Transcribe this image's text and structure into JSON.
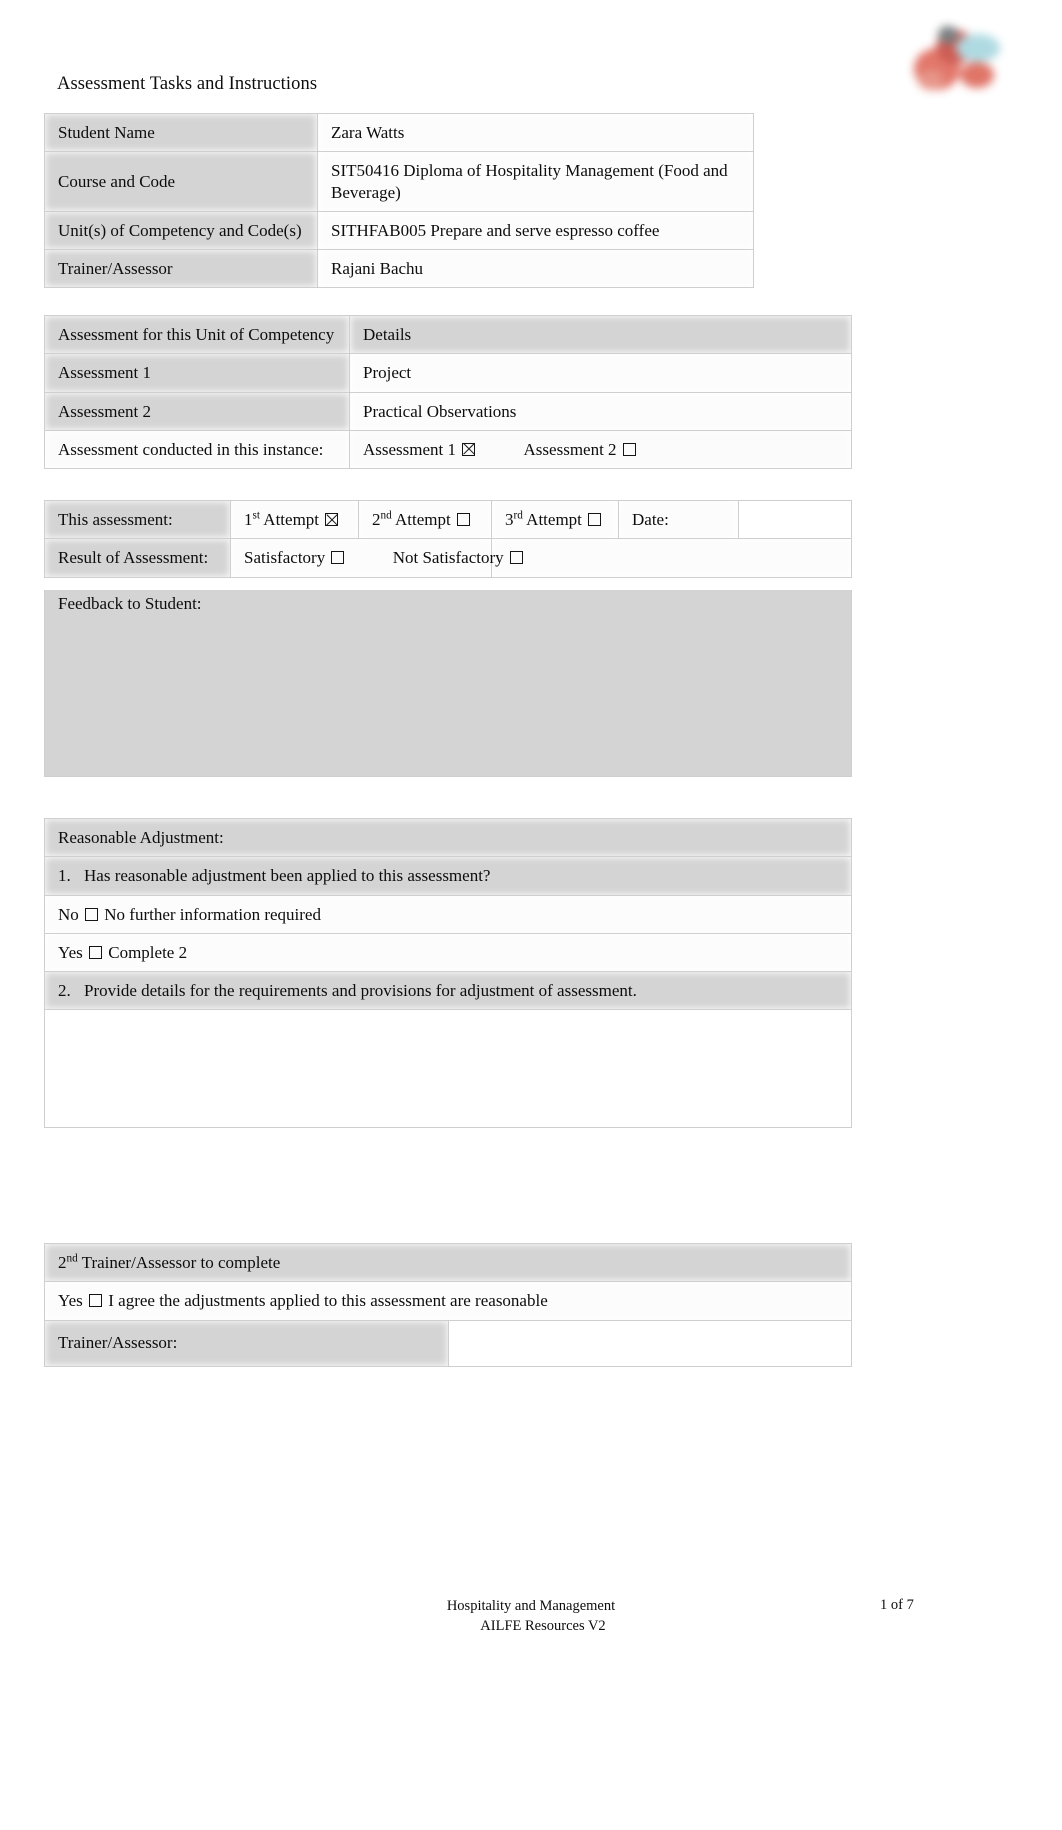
{
  "document": {
    "title": "Assessment Tasks and Instructions",
    "logo_colors": [
      "#e06c5f",
      "#c94f46",
      "#a9d7e0",
      "#dd6a5c",
      "#6e7476"
    ]
  },
  "student_table": {
    "rows": [
      {
        "label": "Student Name",
        "value": "Zara Watts"
      },
      {
        "label": "Course and Code",
        "value": "SIT50416 Diploma of Hospitality Management (Food and Beverage)"
      },
      {
        "label": "Unit(s) of Competency and Code(s)",
        "value": "SITHFAB005 Prepare and serve espresso coffee"
      },
      {
        "label": "Trainer/Assessor",
        "value": "Rajani Bachu"
      }
    ]
  },
  "assessments_table": {
    "header": {
      "label": "Assessment for this Unit of Competency",
      "details": "Details"
    },
    "rows": [
      {
        "label": "Assessment 1",
        "details": "Project"
      },
      {
        "label": "Assessment 2",
        "details": "Practical Observations"
      }
    ],
    "conducted": {
      "label": "Assessment conducted in this instance:",
      "option1": "Assessment 1",
      "option1_checked": true,
      "option2": "Assessment 2",
      "option2_checked": false
    }
  },
  "attempt_table": {
    "label": "This assessment:",
    "attempt1": {
      "ordinal": "1",
      "sup": "st",
      "text": "Attempt",
      "checked": true
    },
    "attempt2": {
      "ordinal": "2",
      "sup": "nd",
      "text": "Attempt",
      "checked": false
    },
    "attempt3": {
      "ordinal": "3",
      "sup": "rd",
      "text": "Attempt",
      "checked": false
    },
    "date_label": "Date:",
    "date_value": "",
    "result_label": "Result of Assessment:",
    "satisfactory": {
      "label": "Satisfactory",
      "checked": false
    },
    "not_satisfactory": {
      "label": "Not Satisfactory",
      "checked": false
    },
    "feedback_label": "Feedback to Student:",
    "feedback_value": ""
  },
  "adjustment": {
    "heading": "Reasonable Adjustment:",
    "q1_number": "1.",
    "q1_text": "Has reasonable adjustment been applied to this assessment?",
    "no_label": "No",
    "no_checked": false,
    "no_text": "No further information required",
    "yes_label": "Yes",
    "yes_checked": false,
    "yes_text": "Complete 2",
    "q2_number": "2.",
    "q2_text": "Provide details for the requirements and provisions for adjustment of assessment.",
    "details_value": ""
  },
  "second_trainer": {
    "heading_ordinal": "2",
    "heading_sup": "nd",
    "heading_text": "Trainer/Assessor to complete",
    "agree_label": "Yes",
    "agree_checked": false,
    "agree_text": "I agree the adjustments applied to this assessment are reasonable",
    "signature_label": "Trainer/Assessor:",
    "signature_value": ""
  },
  "footer": {
    "line1": "Hospitality and Management",
    "line2": "AILFE Resources V2",
    "page": "1 of 7"
  }
}
